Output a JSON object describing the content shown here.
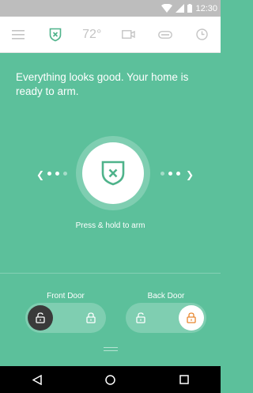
{
  "status_bar": {
    "time": "12:30"
  },
  "nav": {
    "items": [
      {
        "icon": "menu-icon"
      },
      {
        "icon": "shield-icon",
        "active": true
      },
      {
        "label": "72°"
      },
      {
        "icon": "camera-icon"
      },
      {
        "icon": "garage-icon"
      },
      {
        "icon": "clock-icon"
      }
    ]
  },
  "main": {
    "message": "Everything looks good. Your home is ready to arm.",
    "hint": "Press & hold to arm"
  },
  "locks": {
    "front": {
      "label": "Front Door",
      "state": "locked"
    },
    "back": {
      "label": "Back Door",
      "state": "unlocked"
    }
  },
  "colors": {
    "background": "#5cc09b",
    "accent": "#4fb38b",
    "unlocked_accent": "#e8862e",
    "locked_fill": "#3a3a3a"
  }
}
